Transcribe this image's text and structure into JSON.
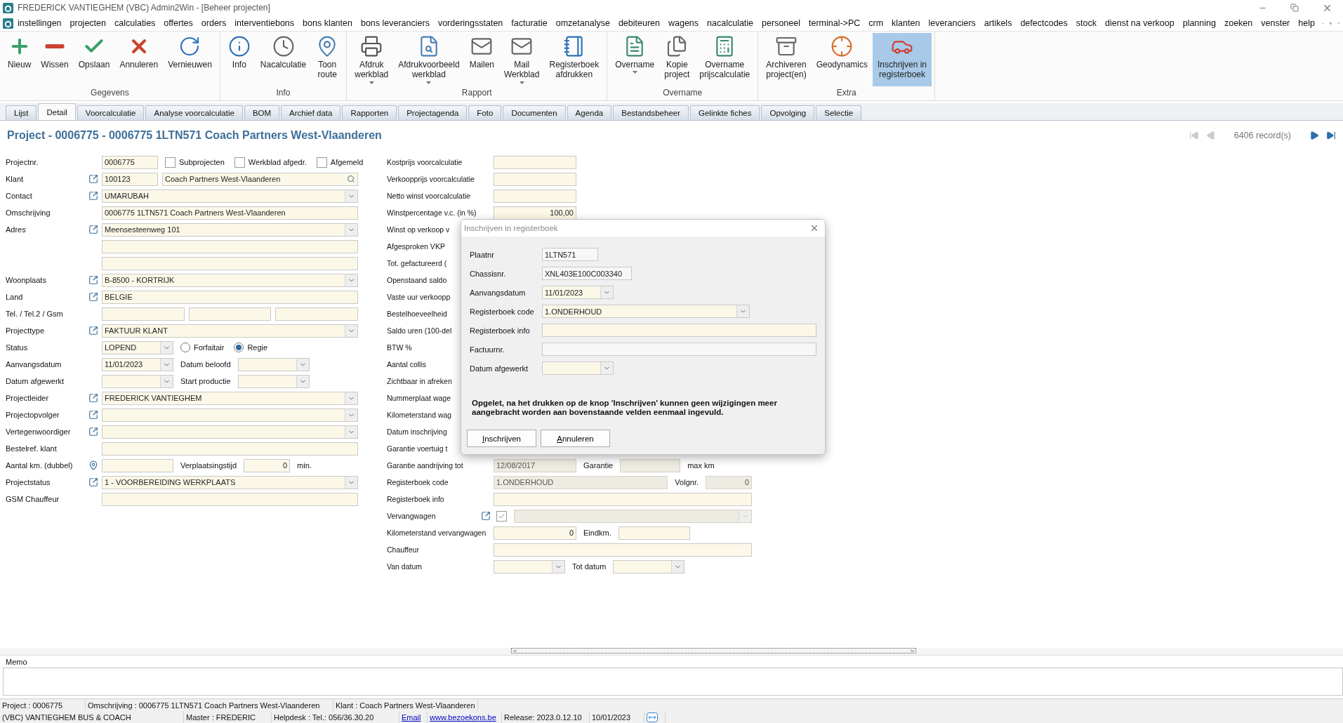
{
  "window": {
    "title": "FREDERICK VANTIEGHEM (VBC) Admin2Win - [Beheer projecten]"
  },
  "menu": [
    "instellingen",
    "projecten",
    "calculaties",
    "offertes",
    "orders",
    "interventiebons",
    "bons klanten",
    "bons leveranciers",
    "vorderingsstaten",
    "facturatie",
    "omzetanalyse",
    "debiteuren",
    "wagens",
    "nacalculatie",
    "personeel",
    "terminal->PC",
    "crm",
    "klanten",
    "leveranciers",
    "artikels",
    "defectcodes",
    "stock",
    "dienst na verkoop",
    "planning",
    "zoeken",
    "venster",
    "help"
  ],
  "ribbon": {
    "groups": [
      {
        "title": "Gegevens",
        "buttons": [
          {
            "label": "Nieuw",
            "dropdown": false,
            "selected": false
          },
          {
            "label": "Wissen",
            "dropdown": false,
            "selected": false
          },
          {
            "label": "Opslaan",
            "dropdown": false,
            "selected": false
          },
          {
            "label": "Annuleren",
            "dropdown": false,
            "selected": false
          },
          {
            "label": "Vernieuwen",
            "dropdown": false,
            "selected": false
          }
        ]
      },
      {
        "title": "Info",
        "buttons": [
          {
            "label": "Info",
            "dropdown": false,
            "selected": false
          },
          {
            "label": "Nacalculatie",
            "dropdown": false,
            "selected": false
          },
          {
            "label": "Toon\nroute",
            "dropdown": false,
            "selected": false
          }
        ]
      },
      {
        "title": "Rapport",
        "buttons": [
          {
            "label": "Afdruk\nwerkblad",
            "dropdown": true,
            "selected": false
          },
          {
            "label": "Afdrukvoorbeeld\nwerkblad",
            "dropdown": true,
            "selected": false
          },
          {
            "label": "Mailen",
            "dropdown": false,
            "selected": false
          },
          {
            "label": "Mail\nWerkblad",
            "dropdown": true,
            "selected": false
          },
          {
            "label": "Registerboek\nafdrukken",
            "dropdown": false,
            "selected": false
          }
        ]
      },
      {
        "title": "Overname",
        "buttons": [
          {
            "label": "Overname",
            "dropdown": true,
            "selected": false
          },
          {
            "label": "Kopie\nproject",
            "dropdown": false,
            "selected": false
          },
          {
            "label": "Overname\nprijscalculatie",
            "dropdown": false,
            "selected": false
          }
        ]
      },
      {
        "title": "Extra",
        "buttons": [
          {
            "label": "Archiveren\nproject(en)",
            "dropdown": false,
            "selected": false
          },
          {
            "label": "Geodynamics",
            "dropdown": false,
            "selected": false
          },
          {
            "label": "Inschrijven in\nregisterboek",
            "dropdown": false,
            "selected": true
          }
        ]
      }
    ]
  },
  "tabs": [
    {
      "label": "Lijst",
      "selected": false
    },
    {
      "label": "Detail",
      "selected": true
    },
    {
      "label": "Voorcalculatie",
      "selected": false
    },
    {
      "label": "Analyse voorcalculatie",
      "selected": false
    },
    {
      "label": "BOM",
      "selected": false
    },
    {
      "label": "Archief data",
      "selected": false
    },
    {
      "label": "Rapporten",
      "selected": false
    },
    {
      "label": "Projectagenda",
      "selected": false
    },
    {
      "label": "Foto",
      "selected": false
    },
    {
      "label": "Documenten",
      "selected": false
    },
    {
      "label": "Agenda",
      "selected": false
    },
    {
      "label": "Bestandsbeheer",
      "selected": false
    },
    {
      "label": "Gelinkte fiches",
      "selected": false
    },
    {
      "label": "Opvolging",
      "selected": false
    },
    {
      "label": "Selectie",
      "selected": false
    }
  ],
  "record": {
    "title": "Project - 0006775 - 0006775 1LTN571 Coach Partners West-Vlaanderen",
    "count": "6406 record(s)",
    "nav_buttons": [
      {
        "kind": "first",
        "disabled": true
      },
      {
        "kind": "previous",
        "disabled": true
      },
      {
        "kind": "next",
        "disabled": false
      },
      {
        "kind": "last",
        "disabled": false
      }
    ]
  },
  "left_rows": [
    {
      "label": "Projectnr.",
      "controls": [
        {
          "kind": "code",
          "value": "0006775"
        },
        {
          "kind": "check",
          "label": "Subprojecten",
          "checked": false
        },
        {
          "kind": "check",
          "label": "Werkblad afgedr.",
          "checked": false
        },
        {
          "kind": "check",
          "label": "Afgemeld",
          "checked": false
        }
      ]
    },
    {
      "label": "Klant",
      "kind": "link",
      "controls": [
        {
          "kind": "code",
          "value": "100123"
        },
        {
          "kind": "search",
          "value": "Coach Partners West-Vlaanderen"
        }
      ]
    },
    {
      "label": "Contact",
      "kind": "link",
      "controls": [
        {
          "kind": "combo",
          "value": "UMARUBAH"
        }
      ]
    },
    {
      "label": "Omschrijving",
      "controls": [
        {
          "kind": "text",
          "value": "0006775 1LTN571 Coach Partners West-Vlaanderen"
        }
      ]
    },
    {
      "label": "Adres",
      "kind": "link",
      "controls": [
        {
          "kind": "combo",
          "value": "Meensesteenweg 101"
        }
      ]
    },
    {
      "controls": [
        {
          "kind": "text"
        }
      ]
    },
    {
      "controls": [
        {
          "kind": "text"
        }
      ]
    },
    {
      "label": "Woonplaats",
      "kind": "link",
      "controls": [
        {
          "kind": "combo",
          "value": "B-8500 - KORTRIJK"
        }
      ]
    },
    {
      "label": "Land",
      "kind": "link",
      "controls": [
        {
          "kind": "text",
          "value": "BELGIE"
        }
      ]
    },
    {
      "label": "Tel. / Tel.2 / Gsm",
      "controls": [
        {
          "kind": "text"
        },
        {
          "kind": "text"
        },
        {
          "kind": "text"
        }
      ]
    },
    {
      "label": "Projecttype",
      "kind": "link",
      "controls": [
        {
          "kind": "combo",
          "value": "FAKTUUR KLANT"
        }
      ]
    },
    {
      "label": "Status",
      "controls": [
        {
          "kind": "date",
          "value": "LOPEND"
        },
        {
          "kind": "radio",
          "label": "Forfaitair",
          "selected": false
        },
        {
          "kind": "radio",
          "label": "Regie",
          "selected": true
        }
      ]
    },
    {
      "label": "Aanvangsdatum",
      "controls": [
        {
          "kind": "date",
          "value": "11/01/2023"
        },
        {
          "kind": "caption",
          "label": "Datum beloofd"
        },
        {
          "kind": "date"
        }
      ]
    },
    {
      "label": "Datum afgewerkt",
      "controls": [
        {
          "kind": "date"
        },
        {
          "kind": "caption",
          "label": "Start productie"
        },
        {
          "kind": "date"
        }
      ]
    },
    {
      "label": "Projectleider",
      "kind": "link",
      "controls": [
        {
          "kind": "combo",
          "value": "FREDERICK VANTIEGHEM"
        }
      ]
    },
    {
      "label": "Projectopvolger",
      "kind": "link",
      "controls": [
        {
          "kind": "combo"
        }
      ]
    },
    {
      "label": "Vertegenwoordiger",
      "kind": "link",
      "controls": [
        {
          "kind": "combo"
        }
      ]
    },
    {
      "label": "Bestelref. klant",
      "controls": [
        {
          "kind": "text"
        }
      ]
    },
    {
      "label": "Aantal km. (dubbel)",
      "kind": "pin",
      "controls": [
        {
          "kind": "short"
        },
        {
          "kind": "caption",
          "label": "Verplaatsingstijd"
        },
        {
          "kind": "number",
          "value": "0"
        },
        {
          "kind": "caption",
          "label": "min."
        }
      ]
    },
    {
      "label": "Projectstatus",
      "kind": "link",
      "controls": [
        {
          "kind": "combo",
          "value": "1 - VOORBEREIDING WERKPLAATS"
        }
      ]
    },
    {
      "label": "GSM Chauffeur",
      "controls": [
        {
          "kind": "text"
        }
      ]
    }
  ],
  "middle_rows": [
    {
      "label": "Kostprijs voorcalculatie",
      "controls": [
        {
          "kind": "amount"
        }
      ]
    },
    {
      "label": "Verkoopprijs voorcalculatie",
      "controls": [
        {
          "kind": "amount"
        }
      ]
    },
    {
      "label": "Netto winst voorcalculatie",
      "controls": [
        {
          "kind": "amount"
        }
      ]
    },
    {
      "label": "Winstpercentage v.c. (in %)",
      "controls": [
        {
          "kind": "amount",
          "value": "100,00"
        }
      ]
    },
    {
      "label": "Winst op verkoop v"
    },
    {
      "label": "Afgesproken VKP"
    },
    {
      "label": "Tot. gefactureerd ("
    },
    {
      "label": "Openstaand saldo"
    },
    {
      "label": "Vaste uur verkoopp"
    },
    {
      "label": "Bestelhoeveelheid"
    },
    {
      "label": "Saldo uren (100-del"
    },
    {
      "label": "BTW %"
    },
    {
      "label": "Aantal collis"
    },
    {
      "label": "Zichtbaar in afreken"
    },
    {
      "label": "Nummerplaat wage"
    },
    {
      "label": "Kilometerstand wag"
    },
    {
      "label": "Datum inschrijving"
    },
    {
      "label": "Garantie voertuig t"
    },
    {
      "label": "Garantie aandrijving tot",
      "controls": [
        {
          "kind": "amount",
          "value": "12/08/2017",
          "disabled": true
        },
        {
          "kind": "caption",
          "label": "Garantie"
        },
        {
          "kind": "medium",
          "disabled": true
        },
        {
          "kind": "caption",
          "label": "max km"
        }
      ]
    },
    {
      "label": "Registerboek code",
      "controls": [
        {
          "kind": "text",
          "value": "1.ONDERHOUD",
          "disabled": true
        },
        {
          "kind": "caption",
          "label": "Volgnr."
        },
        {
          "kind": "number",
          "value": "0",
          "disabled": true
        }
      ]
    },
    {
      "label": "Registerboek info",
      "controls": [
        {
          "kind": "text"
        }
      ]
    },
    {
      "label": "Vervangwagen",
      "kind": "link",
      "controls": [
        {
          "kind": "check",
          "checked": true
        },
        {
          "kind": "combo",
          "disabled": true
        }
      ]
    },
    {
      "label": "Kilometerstand vervangwagen",
      "controls": [
        {
          "kind": "amount",
          "value": "0"
        },
        {
          "kind": "caption",
          "label": "Eindkm."
        },
        {
          "kind": "short"
        }
      ]
    },
    {
      "label": "Chauffeur",
      "controls": [
        {
          "kind": "text"
        }
      ]
    },
    {
      "label": "Van datum",
      "controls": [
        {
          "kind": "date"
        },
        {
          "kind": "caption",
          "label": "Tot datum"
        },
        {
          "kind": "date"
        }
      ]
    }
  ],
  "dialog": {
    "title": "Inschrijven in registerboek",
    "rows": [
      {
        "label": "Plaatnr",
        "controls": [
          {
            "kind": "code",
            "value": "1LTN571",
            "readonly": true
          }
        ]
      },
      {
        "label": "Chassisnr.",
        "controls": [
          {
            "kind": "serial",
            "value": "XNL403E100C003340",
            "readonly": true
          }
        ]
      },
      {
        "label": "Aanvangsdatum",
        "controls": [
          {
            "kind": "date",
            "value": "11/01/2023"
          }
        ]
      },
      {
        "label": "Registerboek code",
        "controls": [
          {
            "kind": "wide",
            "value": "1.ONDERHOUD"
          }
        ]
      },
      {
        "label": "Registerboek info",
        "controls": [
          {
            "kind": "text"
          }
        ]
      },
      {
        "label": "Factuurnr.",
        "controls": [
          {
            "kind": "text",
            "readonly": true
          }
        ]
      },
      {
        "label": "Datum afgewerkt",
        "controls": [
          {
            "kind": "date"
          }
        ]
      }
    ],
    "message": "Opgelet, na het drukken op de knop 'Inschrijven' kunnen geen wijzigingen meer aangebracht worden aan bovenstaande velden eenmaal ingevuld.",
    "buttons": [
      "Inschrijven",
      "Annuleren"
    ]
  },
  "memo": {
    "label": "Memo"
  },
  "status_bar": [
    [
      {
        "kind": "text",
        "text": "Project : 0006775"
      },
      {
        "kind": "text",
        "text": "Omschrijving : 0006775 1LTN571 Coach Partners West-Vlaanderen"
      },
      {
        "kind": "text",
        "text": "Klant : Coach Partners West-Vlaanderen"
      }
    ],
    [
      {
        "kind": "text",
        "text": "(VBC) VANTIEGHEM BUS & COACH"
      },
      {
        "kind": "text",
        "text": "Master : FREDERIC"
      },
      {
        "kind": "text",
        "text": "Helpdesk : Tel.: 056/36.30.20"
      },
      {
        "kind": "link",
        "text": "Email"
      },
      {
        "kind": "link",
        "text": "www.bezoekons.be"
      },
      {
        "kind": "text",
        "text": "Release: 2023.0.12.10"
      },
      {
        "kind": "text",
        "text": "10/01/2023"
      },
      {
        "kind": "remote"
      }
    ]
  ]
}
